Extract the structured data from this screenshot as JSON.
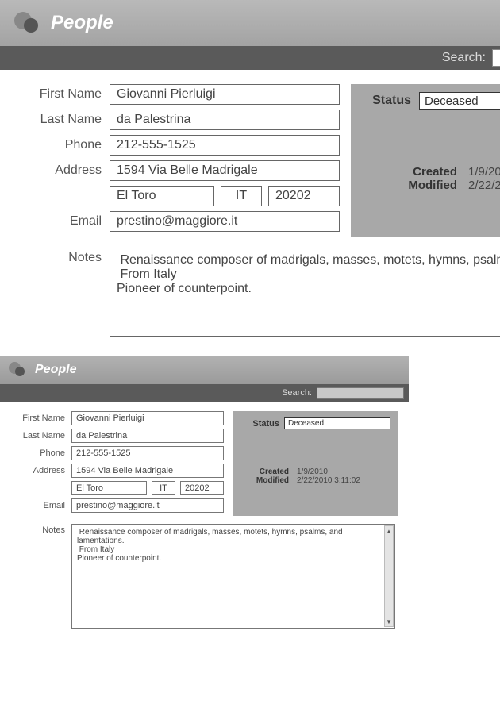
{
  "header": {
    "title": "People"
  },
  "search": {
    "label": "Search:",
    "value": ""
  },
  "labels": {
    "first_name": "First Name",
    "last_name": "Last Name",
    "phone": "Phone",
    "address": "Address",
    "email": "Email",
    "notes": "Notes",
    "status": "Status",
    "created": "Created",
    "modified": "Modified"
  },
  "person": {
    "first_name": "Giovanni Pierluigi",
    "last_name": "da Palestrina",
    "phone": "212-555-1525",
    "street": "1594 Via Belle Madrigale",
    "city": "El Toro",
    "state": "IT",
    "zip": "20202",
    "email": "prestino@maggiore.it",
    "notes": " Renaissance composer of madrigals, masses, motets, hymns, psalms, and lamentations.\n From Italy\nPioneer of counterpoint.",
    "status": "Deceased",
    "created": "1/9/2010",
    "modified_full": "2/22/2010 3:11:02",
    "modified_short": "2/22/20"
  },
  "icons": {
    "people": "people-icon"
  }
}
